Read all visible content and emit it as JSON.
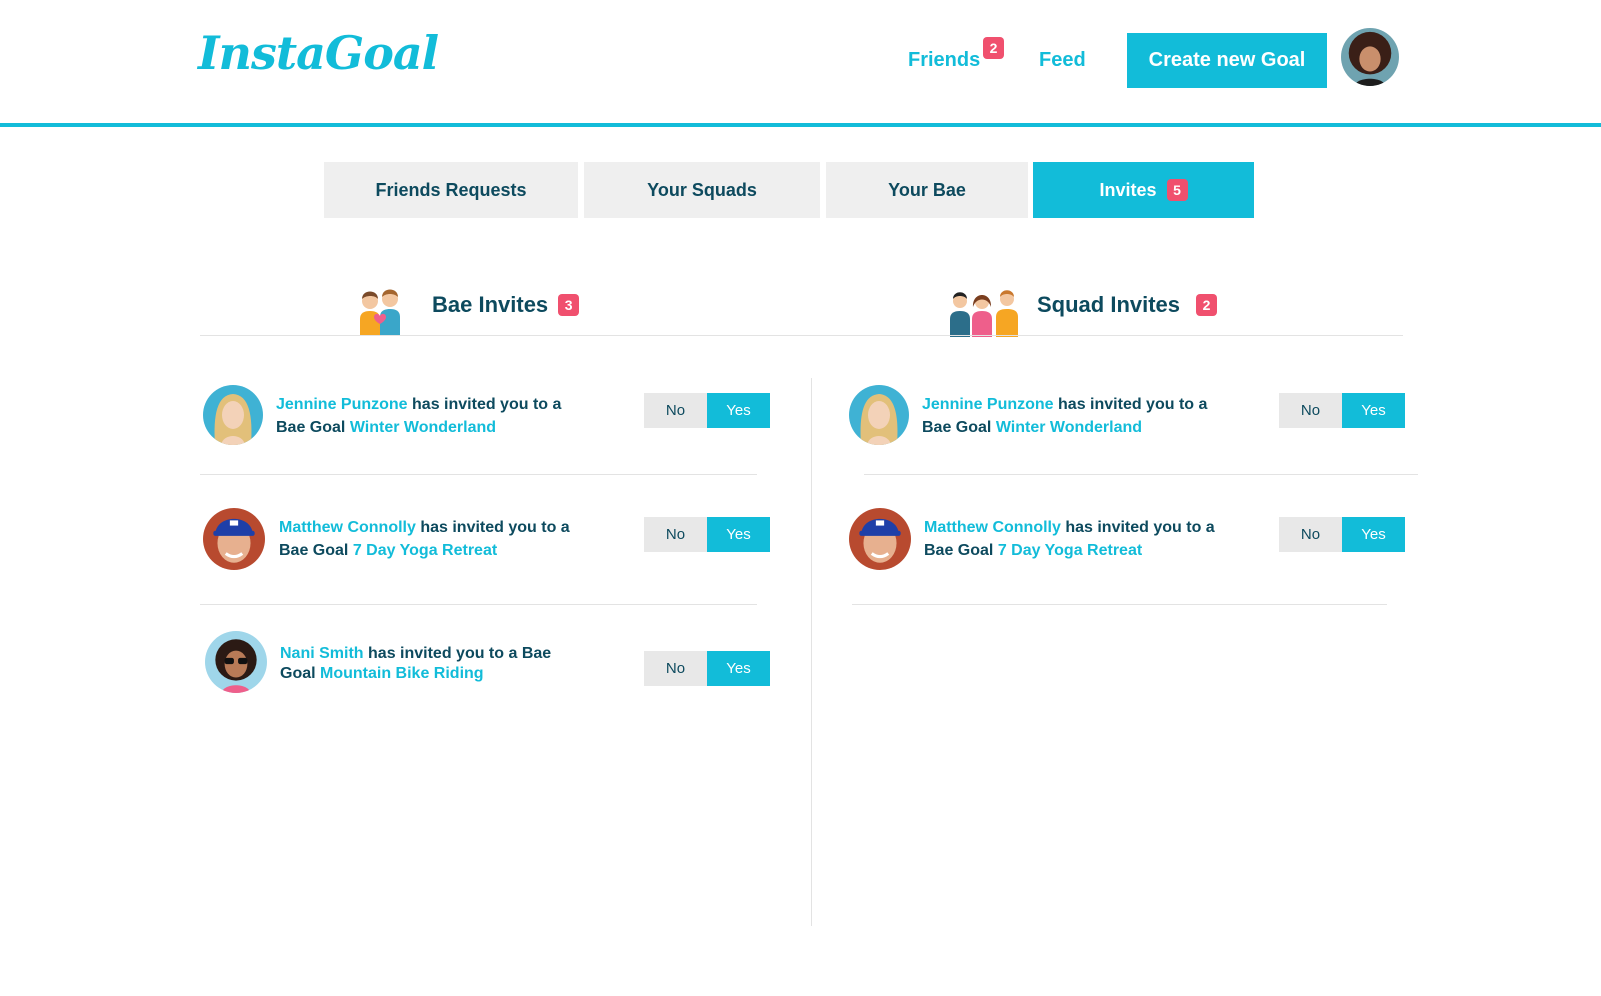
{
  "header": {
    "logo": "InstaGoal",
    "friends_label": "Friends",
    "friends_badge": "2",
    "feed_label": "Feed",
    "create_label": "Create new Goal"
  },
  "tabs": [
    {
      "label": "Friends Requests"
    },
    {
      "label": "Your Squads"
    },
    {
      "label": "Your Bae"
    },
    {
      "label": "Invites",
      "badge": "5"
    }
  ],
  "bae_invites": {
    "title": "Bae Invites",
    "count": "3",
    "items": [
      {
        "name": "Jennine Punzone",
        "text": "has invited you to a Bae Goal",
        "goal": "Winter Wonderland",
        "no": "No",
        "yes": "Yes"
      },
      {
        "name": "Matthew Connolly",
        "text": "has invited you to a Bae Goal",
        "goal": "7 Day Yoga Retreat",
        "no": "No",
        "yes": "Yes"
      },
      {
        "name": "Nani Smith",
        "text": "has invited you to a Bae Goal",
        "goal": "Mountain Bike Riding",
        "no": "No",
        "yes": "Yes"
      }
    ]
  },
  "squad_invites": {
    "title": "Squad Invites",
    "count": "2",
    "items": [
      {
        "name": "Jennine Punzone",
        "text": "has invited you to a Bae Goal",
        "goal": "Winter Wonderland",
        "no": "No",
        "yes": "Yes"
      },
      {
        "name": "Matthew Connolly",
        "text": "has invited you to a Bae Goal",
        "goal": "7 Day Yoga Retreat",
        "no": "No",
        "yes": "Yes"
      }
    ]
  },
  "colors": {
    "accent": "#12bcd9",
    "badge": "#f0506e",
    "text": "#0d4a5e",
    "tab_bg": "#efefef"
  },
  "icons": [
    "couple-illustration",
    "squad-illustration",
    "user-avatar"
  ]
}
